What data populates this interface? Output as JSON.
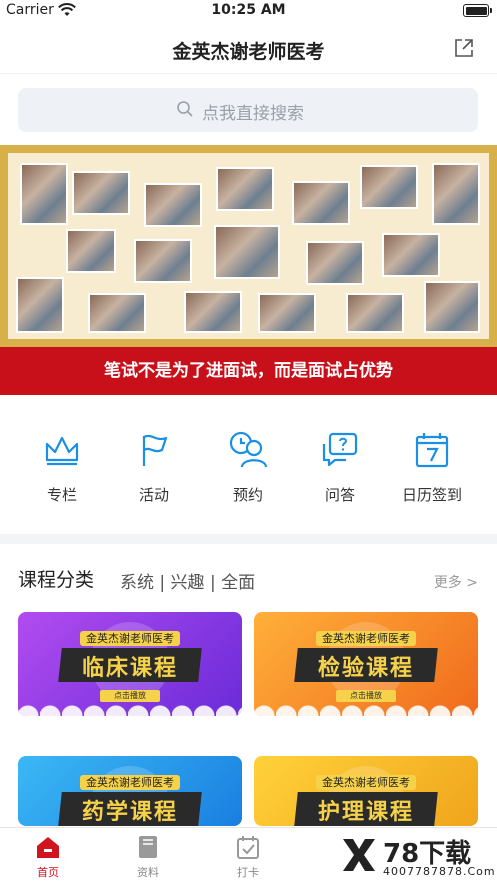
{
  "status_bar": {
    "carrier": "Carrier",
    "time": "10:25 AM"
  },
  "nav": {
    "title": "金英杰谢老师医考"
  },
  "search": {
    "placeholder": "点我直接搜索"
  },
  "banner": {
    "slogan": "笔试不是为了进面试，而是面试占优势"
  },
  "quick_actions": [
    {
      "label": "专栏",
      "icon": "crown-icon"
    },
    {
      "label": "活动",
      "icon": "flag-icon"
    },
    {
      "label": "预约",
      "icon": "clock-user-icon"
    },
    {
      "label": "问答",
      "icon": "chat-question-icon"
    },
    {
      "label": "日历签到",
      "icon": "calendar-icon"
    }
  ],
  "courses_section": {
    "title": "课程分类",
    "tags": "系统 | 兴趣 | 全面",
    "more": "更多 >"
  },
  "courses": [
    {
      "brand": "金英杰谢老师医考",
      "name": "临床课程",
      "play": "点击播放",
      "color": "#8a3be0"
    },
    {
      "brand": "金英杰谢老师医考",
      "name": "检验课程",
      "play": "点击播放",
      "color": "#f07a20"
    },
    {
      "brand": "金英杰谢老师医考",
      "name": "药学课程",
      "play": "",
      "color": "#1e9be6"
    },
    {
      "brand": "金英杰谢老师医考",
      "name": "护理课程",
      "play": "",
      "color": "#f2a81c"
    }
  ],
  "tab_bar": [
    {
      "label": "首页",
      "icon": "home-icon",
      "active": true
    },
    {
      "label": "资料",
      "icon": "book-icon",
      "active": false
    },
    {
      "label": "打卡",
      "icon": "calendar-check-icon",
      "active": false
    }
  ],
  "watermark": {
    "brand": "78下载",
    "url": "4007787878.Com"
  },
  "colors": {
    "accent": "#1a8fe3",
    "brand_red": "#c8101a"
  }
}
